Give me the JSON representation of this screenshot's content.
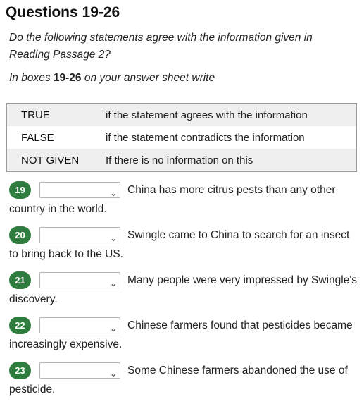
{
  "heading": "Questions 19-26",
  "instruction": "Do the following statements agree with the information given in Reading Passage 2?",
  "sheet": {
    "prefix": "In boxes ",
    "range": "19-26",
    "suffix": " on your answer sheet write"
  },
  "key": [
    {
      "term": "TRUE",
      "meaning": "if the statement agrees with the information"
    },
    {
      "term": "FALSE",
      "meaning": "if the statement contradicts the information"
    },
    {
      "term": "NOT GIVEN",
      "meaning": "If there is no information on this"
    }
  ],
  "questions": [
    {
      "number": "19",
      "selected": "",
      "text": "China has more citrus pests than any other country in the world."
    },
    {
      "number": "20",
      "selected": "",
      "text": "Swingle came to China to search for an insect to bring back to the US."
    },
    {
      "number": "21",
      "selected": "",
      "text": "Many people were very impressed by Swingle's discovery."
    },
    {
      "number": "22",
      "selected": "",
      "text": "Chinese farmers found that pesticides became increasingly expensive."
    },
    {
      "number": "23",
      "selected": "",
      "text": "Some Chinese farmers abandoned the use of pesticide."
    }
  ],
  "colors": {
    "badge": "#2e7d3e",
    "table_stripe": "#efefef"
  },
  "icons": {
    "dropdown": "chevron-down-icon"
  }
}
